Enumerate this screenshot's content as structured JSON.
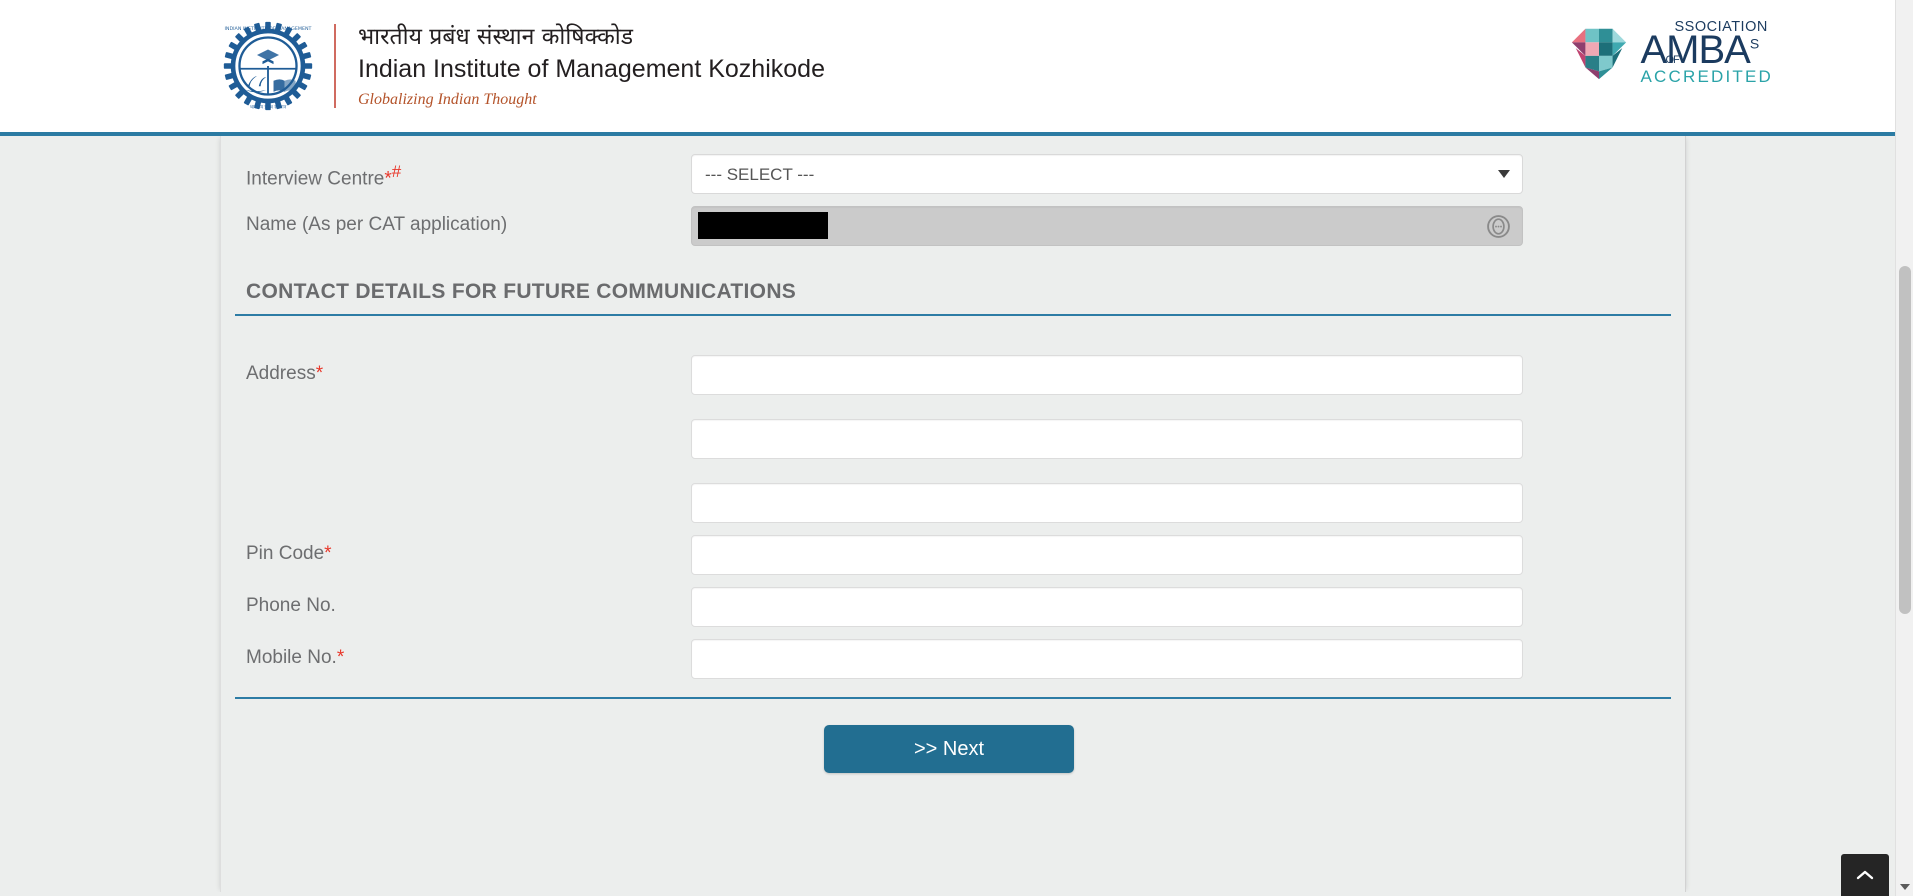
{
  "header": {
    "emblem_icon": "iim-kozhikode-emblem-icon",
    "hindi_title": "भारतीय प्रबंध संस्थान कोषिक्कोड",
    "english_title": "Indian Institute of Management Kozhikode",
    "tagline": "Globalizing Indian Thought",
    "accreditation": {
      "mark_icon": "amba-diamond-icon",
      "line1": "SSOCIATION",
      "of": "OF",
      "main": "MBA",
      "sup": "S",
      "a_letter": "A",
      "accredited": "ACCREDITED"
    }
  },
  "form": {
    "interview_centre": {
      "label": "Interview Centre",
      "required_mark": "*",
      "hash_mark": "#",
      "selected": "--- SELECT ---",
      "options": [
        "--- SELECT ---"
      ]
    },
    "name": {
      "label": "Name (As per CAT application)",
      "value": "",
      "redacted": true,
      "autofill_icon": "lastpass-autofill-icon"
    },
    "section_heading": "CONTACT DETAILS FOR FUTURE COMMUNICATIONS",
    "address": {
      "label": "Address",
      "required_mark": "*",
      "line1": "",
      "line2": "",
      "line3": ""
    },
    "pin_code": {
      "label": "Pin Code",
      "required_mark": "*",
      "value": ""
    },
    "phone_no": {
      "label": "Phone No.",
      "required_mark": "",
      "value": ""
    },
    "mobile_no": {
      "label": "Mobile No.",
      "required_mark": "*",
      "value": ""
    },
    "next_button": ">> Next"
  },
  "widgets": {
    "scroll_to_top_icon": "chevron-up-icon"
  },
  "colors": {
    "accent_blue": "#2d7ca5",
    "button_blue": "#226e91",
    "required_red": "#e8372a",
    "label_gray": "#6d6e70",
    "page_bg": "#eceeed",
    "tagline_brown": "#b4532a",
    "amba_navy": "#1b3b5f",
    "amba_teal": "#2aa3a8"
  }
}
